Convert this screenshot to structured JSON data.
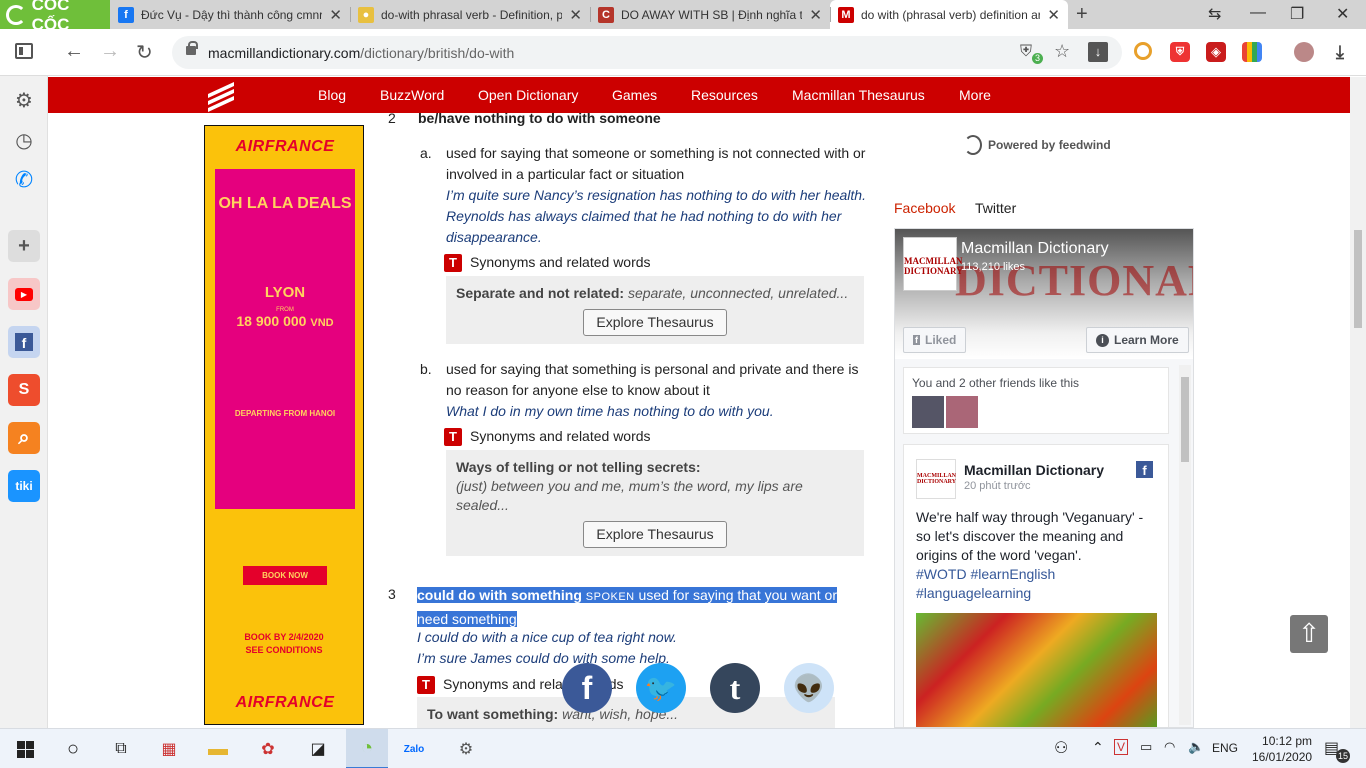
{
  "browser": {
    "brand": "CỐC CỐC",
    "tabs": [
      {
        "title": "Đức Vụ - Dậy thì thành công cmnr",
        "favicon": "facebook-icon",
        "color": "#1877f2"
      },
      {
        "title": "do-with phrasal verb - Definition, p",
        "favicon": "generic-icon",
        "color": "#777777"
      },
      {
        "title": "DO AWAY WITH SB | Định nghĩa tro",
        "favicon": "cambridge-icon",
        "color": "#b5352a"
      },
      {
        "title": "do with (phrasal verb) definition ar",
        "favicon": "macmillan-icon",
        "color": "#cc0000"
      }
    ],
    "url_host": "macmillandictionary.com",
    "url_path": "/dictionary/british/do-with",
    "shield_badge": "3"
  },
  "site_nav": [
    "Blog",
    "BuzzWord",
    "Open Dictionary",
    "Games",
    "Resources",
    "Macmillan Thesaurus",
    "More"
  ],
  "ad": {
    "brand": "AIRFRANCE",
    "headline": "OH LA LA DEALS",
    "city": "LYON",
    "price_from": "FROM",
    "price": "18 900 000",
    "currency": "VND",
    "departing": "DEPARTING FROM HANOI",
    "cta": "BOOK NOW",
    "book_by": "BOOK BY 2/4/2020",
    "conditions": "SEE CONDITIONS"
  },
  "entry": {
    "sense2": {
      "number": "2",
      "headword": "be/have nothing to do with someone",
      "a": {
        "letter": "a.",
        "definition": "used for saying that someone or something is not connected with or involved in a particular fact or situation",
        "examples": [
          "I’m quite sure Nancy’s resignation has nothing to do with her health.",
          "Reynolds has always claimed that he had nothing to do with her disappearance."
        ],
        "syn_label": "Synonyms and related words",
        "thes_heading": "Separate and not related:",
        "thes_words": "separate, unconnected, unrelated...",
        "thes_button": "Explore Thesaurus"
      },
      "b": {
        "letter": "b.",
        "definition": "used for saying that something is personal and private and there is no reason for anyone else to know about it",
        "examples": [
          "What I do in my own time has nothing to do with you."
        ],
        "syn_label": "Synonyms and related words",
        "thes_heading": "Ways of telling or not telling secrets:",
        "thes_words": "(just) between you and me, mum’s the word, my lips are sealed...",
        "thes_button": "Explore Thesaurus"
      }
    },
    "sense3": {
      "number": "3",
      "headword": "could do with something",
      "register": "SPOKEN",
      "definition": "used for saying that you want or need something",
      "examples": [
        "I could do with a nice cup of tea right now.",
        "I’m sure James could do with some help."
      ],
      "syn_label": "Synonyms and related words",
      "thes_heading": "To want something:",
      "thes_words": "want, wish, hope..."
    }
  },
  "right": {
    "powered_by": "Powered by feedwind",
    "tabs": [
      "Facebook",
      "Twitter"
    ],
    "fb": {
      "cover_word": "DICTIONARY",
      "avatar_text": "MACMILLAN DICTIONARY",
      "page_name": "Macmillan Dictionary",
      "likes": "113,210 likes",
      "liked_btn": "Liked",
      "learn_more_btn": "Learn More",
      "friends_text": "You and 2 other friends like this",
      "post_name": "Macmillan Dictionary",
      "post_time": "20 phút trước",
      "post_text": "We're half way through 'Veganuary' - so let's discover the meaning and origins of the word 'vegan'.",
      "post_tags": "#WOTD #learnEnglish #languagelearning"
    }
  },
  "share": [
    {
      "name": "facebook",
      "color": "#3b5998",
      "glyph": "f"
    },
    {
      "name": "twitter",
      "color": "#1da1f2",
      "glyph": "🐦"
    },
    {
      "name": "tumblr",
      "color": "#35465c",
      "glyph": "t"
    },
    {
      "name": "reddit",
      "color": "#cee3f8",
      "glyph": "👽"
    }
  ],
  "taskbar": {
    "lang": "ENG",
    "time": "10:12 pm",
    "date": "16/01/2020",
    "notif_count": "15"
  }
}
